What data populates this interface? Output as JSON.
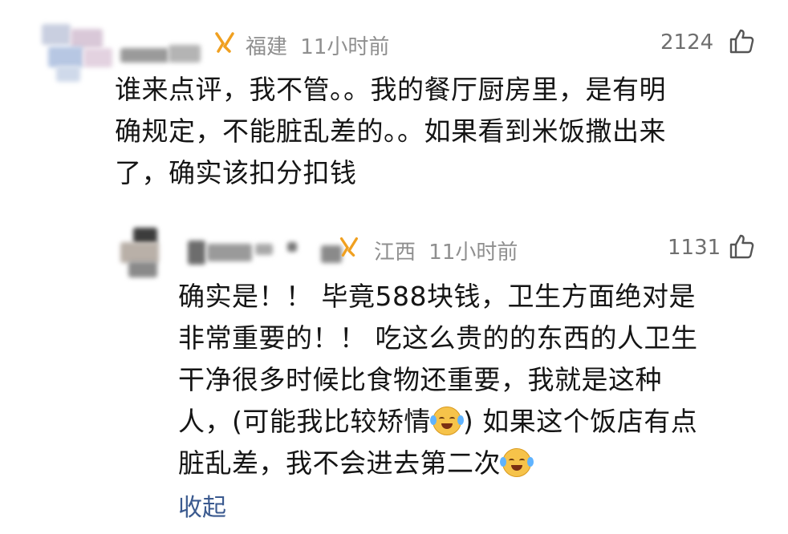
{
  "comment": {
    "region": "福建",
    "time": "11小时前",
    "likes": "2124",
    "lines": [
      "谁来点评，我不管。。我的餐厅厨房里，是有明",
      "确规定，不能脏乱差的。。如果看到米饭撒出来",
      "了，确实该扣分扣钱"
    ]
  },
  "reply": {
    "region": "江西",
    "time": "11小时前",
    "likes": "1131",
    "lines": [
      "确实是！！ 毕竟588块钱，卫生方面绝对是",
      "非常重要的！！ 吃这么贵的的东西的人卫生",
      "干净很多时候比食物还重要，我就是这种"
    ],
    "line4_before_emoji": "人，(可能我比较矫情",
    "line4_after_emoji": ") 如果这个饭店有点",
    "line5_before_emoji": "脏乱差，我不会进去第二次",
    "emoji_name": "laughing-crying-emoji",
    "collapse_label": "收起"
  },
  "colors": {
    "meta": "#8f8f8f",
    "link": "#3b5a8f",
    "badge": "#f0a020"
  }
}
